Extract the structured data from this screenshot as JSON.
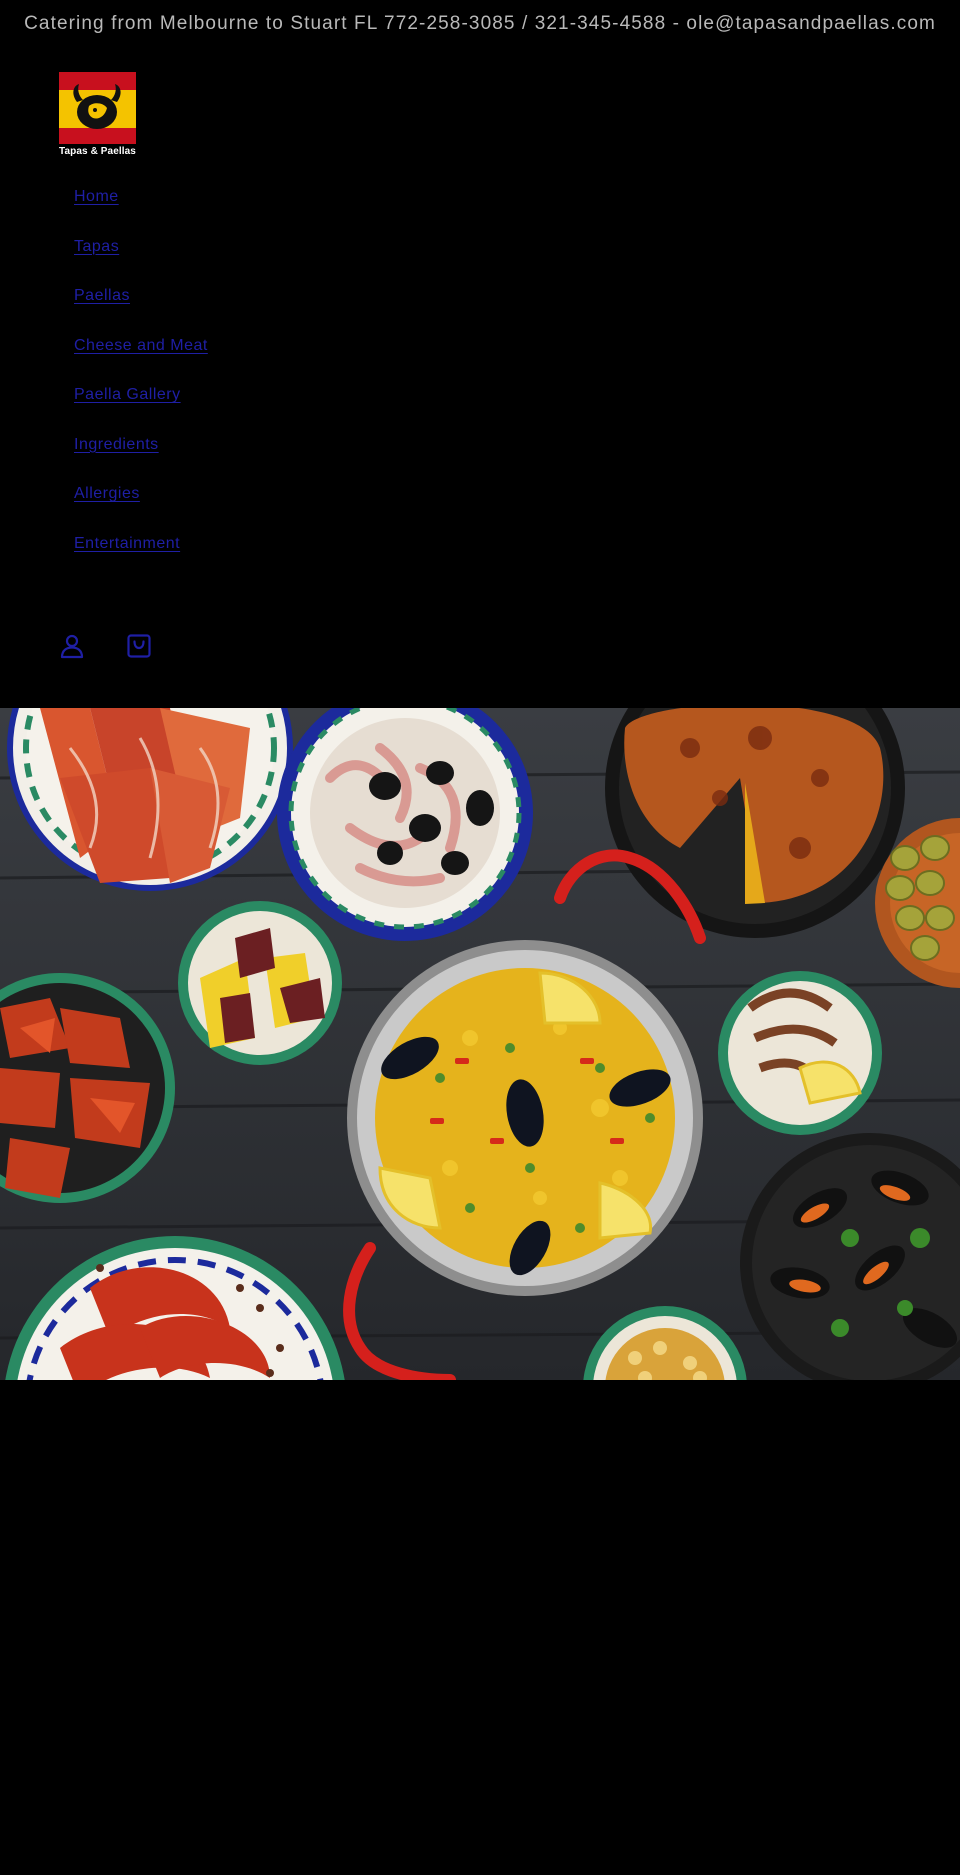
{
  "announcement": {
    "text": "Catering from Melbourne to Stuart FL 772-258-3085 / 321-345-4588 - ole@tapasandpaellas.com"
  },
  "brand": {
    "logo_text": "Tapas & Paellas",
    "logo_colors": {
      "red": "#c8101e",
      "yellow": "#f4c300",
      "bull": "#111111"
    }
  },
  "nav": {
    "items": [
      {
        "label": "Home"
      },
      {
        "label": "Tapas"
      },
      {
        "label": "Paellas"
      },
      {
        "label": "Cheese and Meat"
      },
      {
        "label": "Paella Gallery"
      },
      {
        "label": "Ingredients"
      },
      {
        "label": "Allergies"
      },
      {
        "label": "Entertainment"
      }
    ],
    "link_color": "#1f1fa5"
  },
  "header_icons": {
    "account": "account-icon",
    "cart": "cart-icon"
  },
  "hero": {
    "image": "spanish-tapas-and-paella-table"
  }
}
